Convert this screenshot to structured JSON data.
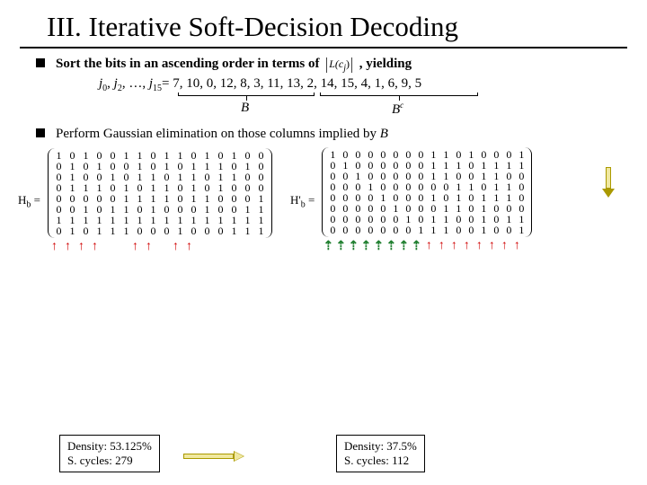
{
  "title": "III. Iterative Soft-Decision Decoding",
  "bullet1": {
    "pre": "Sort the bits in an ascending order in terms of",
    "metric": "L(c",
    "metric_sub": "j",
    "metric_close": ")",
    "post": ", yielding"
  },
  "jseq": {
    "prefix": "j",
    "items_label": "= 7, 10, 0, 12, 8, 3, 11, 13, 2, 14, 15, 4, 1, 6, 9, 5",
    "B": "B",
    "Bc": "B",
    "Bc_sup": "c"
  },
  "bullet2": {
    "text": "Perform Gaussian elimination on those columns implied by ",
    "tail": "B"
  },
  "matrixA": {
    "label": "H",
    "label_sub": "b",
    "rows": [
      [
        1,
        0,
        1,
        0,
        0,
        1,
        1,
        0,
        1,
        1,
        0,
        1,
        0,
        1,
        0,
        0
      ],
      [
        0,
        1,
        0,
        1,
        0,
        0,
        1,
        0,
        1,
        0,
        1,
        1,
        1,
        0,
        1,
        0
      ],
      [
        0,
        1,
        0,
        0,
        1,
        0,
        1,
        1,
        0,
        1,
        1,
        0,
        1,
        1,
        0,
        0
      ],
      [
        0,
        1,
        1,
        1,
        0,
        1,
        0,
        1,
        1,
        0,
        1,
        0,
        1,
        0,
        0,
        0
      ],
      [
        0,
        0,
        0,
        0,
        0,
        1,
        1,
        1,
        1,
        0,
        1,
        1,
        0,
        0,
        0,
        1
      ],
      [
        0,
        0,
        1,
        0,
        1,
        1,
        0,
        1,
        0,
        0,
        0,
        1,
        0,
        0,
        1,
        1
      ],
      [
        1,
        1,
        1,
        1,
        1,
        1,
        1,
        1,
        1,
        1,
        1,
        1,
        1,
        1,
        1,
        1
      ],
      [
        0,
        1,
        0,
        1,
        1,
        1,
        0,
        0,
        0,
        1,
        0,
        0,
        0,
        1,
        1,
        1
      ]
    ],
    "arrows": [
      "r",
      "r",
      "r",
      "r",
      "",
      "",
      "r",
      "r",
      "",
      "r",
      "r",
      "",
      "",
      "",
      "",
      ""
    ]
  },
  "matrixB": {
    "label": "H'",
    "label_sub": "b",
    "rows": [
      [
        1,
        0,
        0,
        0,
        0,
        0,
        0,
        0,
        1,
        1,
        0,
        1,
        0,
        0,
        0,
        1
      ],
      [
        0,
        1,
        0,
        0,
        0,
        0,
        0,
        0,
        1,
        1,
        1,
        0,
        1,
        1,
        1,
        1
      ],
      [
        0,
        0,
        1,
        0,
        0,
        0,
        0,
        0,
        1,
        1,
        0,
        0,
        1,
        1,
        0,
        0
      ],
      [
        0,
        0,
        0,
        1,
        0,
        0,
        0,
        0,
        0,
        0,
        1,
        1,
        0,
        1,
        1,
        0
      ],
      [
        0,
        0,
        0,
        0,
        1,
        0,
        0,
        0,
        1,
        0,
        1,
        0,
        1,
        1,
        1,
        0
      ],
      [
        0,
        0,
        0,
        0,
        0,
        1,
        0,
        0,
        0,
        1,
        1,
        0,
        1,
        0,
        0,
        0
      ],
      [
        0,
        0,
        0,
        0,
        0,
        0,
        1,
        0,
        1,
        1,
        0,
        0,
        1,
        0,
        1,
        1
      ],
      [
        0,
        0,
        0,
        0,
        0,
        0,
        0,
        1,
        1,
        1,
        0,
        0,
        1,
        0,
        0,
        1
      ]
    ],
    "arrows": [
      "g",
      "g",
      "g",
      "g",
      "g",
      "g",
      "g",
      "g",
      "r",
      "r",
      "r",
      "r",
      "r",
      "r",
      "r",
      "r"
    ]
  },
  "stat1": {
    "line1": "Density: 53.125%",
    "line2": "S. cycles: 279"
  },
  "stat2": {
    "line1": "Density: 37.5%",
    "line2": "S. cycles: 112"
  }
}
